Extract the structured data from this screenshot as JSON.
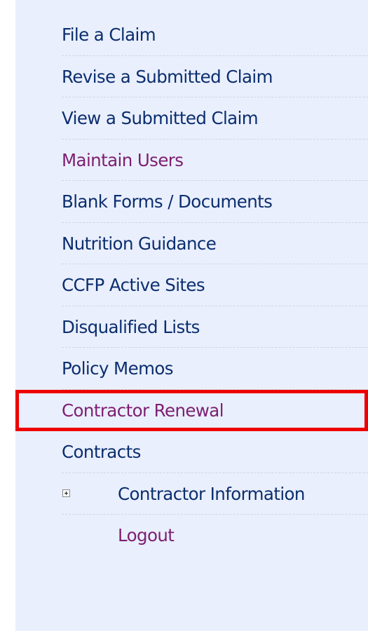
{
  "menu": {
    "items": [
      {
        "label": "File a Claim"
      },
      {
        "label": "Revise a Submitted Claim"
      },
      {
        "label": "View a Submitted Claim"
      },
      {
        "label": "Maintain Users"
      },
      {
        "label": "Blank Forms / Documents"
      },
      {
        "label": "Nutrition Guidance"
      },
      {
        "label": "CCFP Active Sites"
      },
      {
        "label": "Disqualified Lists"
      },
      {
        "label": "Policy Memos"
      },
      {
        "label": "Contractor Renewal"
      },
      {
        "label": "Contracts"
      },
      {
        "label": "Contractor Information"
      },
      {
        "label": "Logout"
      }
    ]
  },
  "colors": {
    "sidebar_bg": "#eaeffd",
    "link": "#0b2e6e",
    "visited_link": "#7c1f72",
    "highlight": "#ee0000"
  },
  "icons": {
    "expander": "plus-box-icon"
  }
}
